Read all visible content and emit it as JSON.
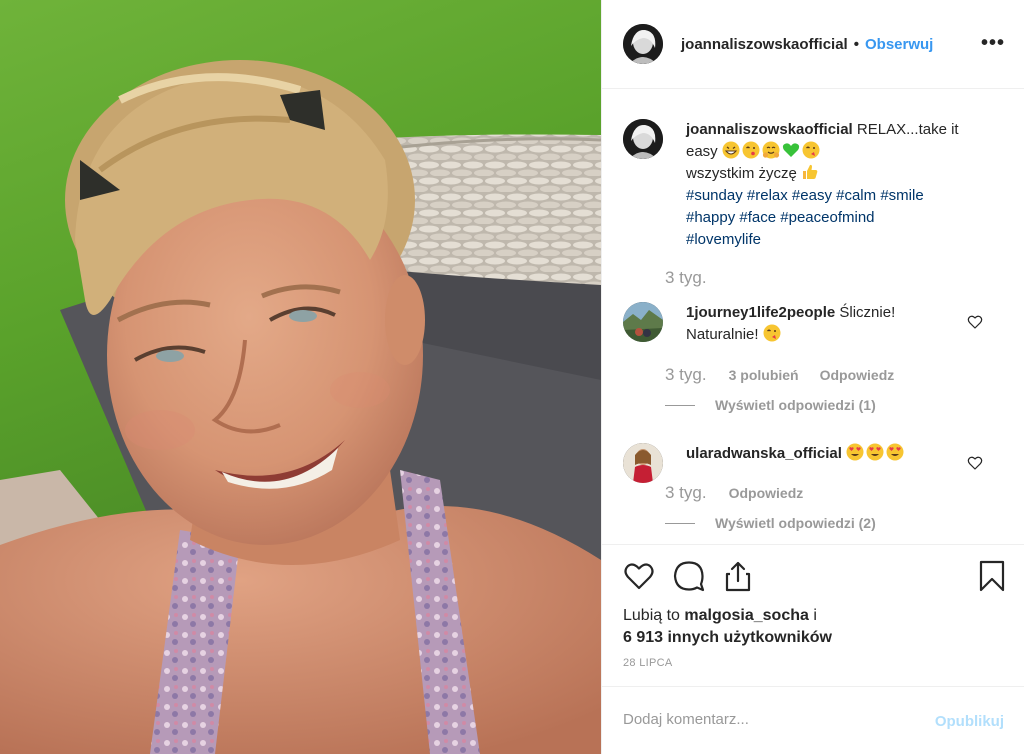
{
  "post": {
    "author": "joannaliszowskaofficial",
    "follow_label": "Obserwuj",
    "more_label": "•••"
  },
  "caption": {
    "author": "joannaliszowskaofficial",
    "text_line1": " RELAX...take it",
    "text_line2": "easy",
    "text_line3": "wszystkim życzę",
    "tags_line1": [
      "#sunday",
      "#relax",
      "#easy",
      "#calm",
      "#smile"
    ],
    "tags_line2": [
      "#happy",
      "#face",
      "#peaceofmind"
    ],
    "tags_line3": [
      "#lovemylife"
    ],
    "time": "3 tyg."
  },
  "comments": [
    {
      "author": "1journey1life2people",
      "text_line1": " Ślicznie!",
      "text_line2": "Naturalnie!",
      "time": "3 tyg.",
      "likes": "3 polubień",
      "reply_label": "Odpowiedz",
      "view_replies": "Wyświetl odpowiedzi (1)"
    },
    {
      "author": "ularadwanska_official",
      "time": "3 tyg.",
      "reply_label": "Odpowiedz",
      "view_replies": "Wyświetl odpowiedzi (2)"
    }
  ],
  "likes_text": {
    "prefix": "Lubią to ",
    "user": "malgosia_socha",
    "suffix": " i",
    "others": "6 913 innych użytkowników"
  },
  "date": "28 LIPCA",
  "add_comment": {
    "placeholder": "Dodaj komentarz...",
    "publish_label": "Opublikuj"
  },
  "colors": {
    "accent": "#3897f0",
    "hashtag": "#003569",
    "muted": "#999999",
    "publish_disabled": "#b2dffc"
  },
  "icons": [
    "heart-icon",
    "comment-icon",
    "share-icon",
    "bookmark-icon",
    "more-icon",
    "small-heart-icon"
  ]
}
